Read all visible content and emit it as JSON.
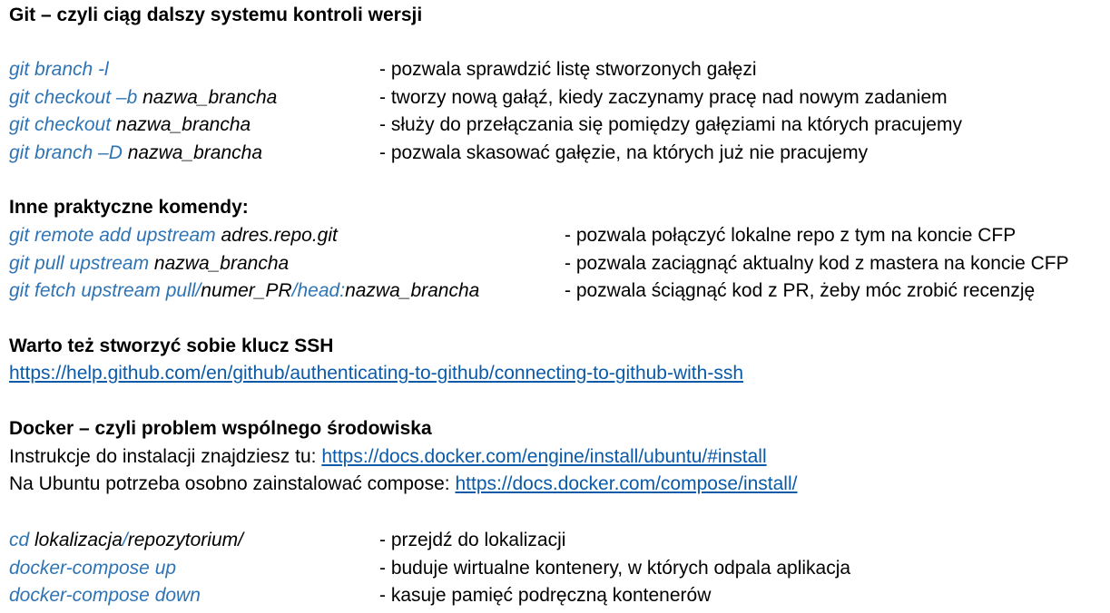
{
  "git": {
    "title": "Git – czyli ciąg dalszy systemu kontroli wersji",
    "commands": [
      {
        "parts": [
          {
            "t": "git branch -l",
            "c": "blue"
          }
        ],
        "desc": "- pozwala sprawdzić listę stworzonych gałęzi"
      },
      {
        "parts": [
          {
            "t": "git checkout –b ",
            "c": "blue"
          },
          {
            "t": "nazwa_brancha",
            "c": "black"
          }
        ],
        "desc": "- tworzy nową gałąź, kiedy zaczynamy pracę nad nowym zadaniem"
      },
      {
        "parts": [
          {
            "t": "git checkout ",
            "c": "blue"
          },
          {
            "t": "nazwa_brancha",
            "c": "black"
          }
        ],
        "desc": "- służy do przełączania się pomiędzy gałęziami na których pracujemy"
      },
      {
        "parts": [
          {
            "t": "git branch –D ",
            "c": "blue"
          },
          {
            "t": "nazwa_brancha",
            "c": "black"
          }
        ],
        "desc": "- pozwala skasować gałęzie, na których już nie pracujemy"
      }
    ]
  },
  "other": {
    "title": "Inne praktyczne komendy:",
    "commands": [
      {
        "parts": [
          {
            "t": "git remote add upstream ",
            "c": "blue"
          },
          {
            "t": "adres.repo.git",
            "c": "black"
          }
        ],
        "desc": "- pozwala połączyć lokalne repo z tym na koncie CFP"
      },
      {
        "parts": [
          {
            "t": "git pull upstream ",
            "c": "blue"
          },
          {
            "t": "nazwa_brancha",
            "c": "black"
          }
        ],
        "desc": "- pozwala zaciągnąć aktualny kod z mastera na koncie CFP"
      },
      {
        "parts": [
          {
            "t": "git fetch upstream pull/",
            "c": "blue"
          },
          {
            "t": "numer_PR",
            "c": "black"
          },
          {
            "t": "/head:",
            "c": "blue"
          },
          {
            "t": "nazwa_brancha",
            "c": "black"
          }
        ],
        "desc": "- pozwala ściągnąć kod z PR, żeby móc zrobić recenzję"
      }
    ]
  },
  "ssh": {
    "title": "Warto też stworzyć sobie klucz SSH",
    "link": "https://help.github.com/en/github/authenticating-to-github/connecting-to-github-with-ssh"
  },
  "docker": {
    "title": "Docker – czyli problem wspólnego środowiska",
    "install_text": "Instrukcje do instalacji znajdziesz tu: ",
    "install_link": "https://docs.docker.com/engine/install/ubuntu/#install",
    "compose_text": "Na Ubuntu potrzeba osobno zainstalować compose: ",
    "compose_link": "https://docs.docker.com/compose/install/",
    "commands": [
      {
        "parts": [
          {
            "t": "cd ",
            "c": "blue"
          },
          {
            "t": "lokalizacja",
            "c": "black"
          },
          {
            "t": "/",
            "c": "blue"
          },
          {
            "t": "repozytorium/",
            "c": "black"
          }
        ],
        "desc": "- przejdź do lokalizacji"
      },
      {
        "parts": [
          {
            "t": "docker-compose up",
            "c": "blue"
          }
        ],
        "desc": "- buduje wirtualne kontenery, w których odpala aplikacja"
      },
      {
        "parts": [
          {
            "t": "docker-compose down",
            "c": "blue"
          }
        ],
        "desc": "- kasuje pamięć podręczną kontenerów"
      }
    ]
  }
}
